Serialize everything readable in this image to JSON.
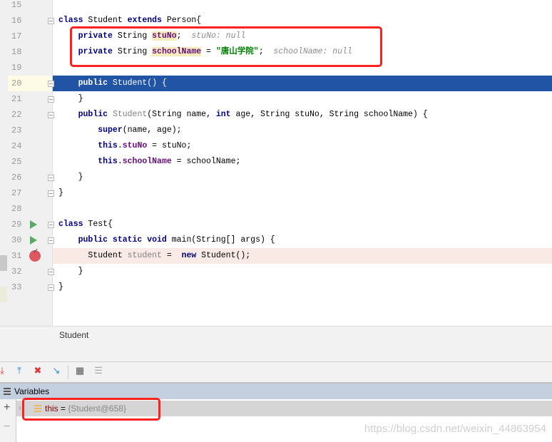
{
  "editor": {
    "lines": [
      {
        "n": "15",
        "tokens": []
      },
      {
        "n": "16",
        "tokens": [
          {
            "t": "class",
            "c": "kw"
          },
          {
            "t": " Student "
          },
          {
            "t": "extends",
            "c": "kw"
          },
          {
            "t": " Person{"
          }
        ]
      },
      {
        "n": "17",
        "tokens": [
          {
            "t": "    "
          },
          {
            "t": "private",
            "c": "kw"
          },
          {
            "t": " String "
          },
          {
            "t": "stuNo",
            "c": "dec"
          },
          {
            "t": ";  "
          },
          {
            "t": "stuNo: null",
            "c": "hint"
          }
        ]
      },
      {
        "n": "18",
        "tokens": [
          {
            "t": "    "
          },
          {
            "t": "private",
            "c": "kw"
          },
          {
            "t": " String "
          },
          {
            "t": "schoolName",
            "c": "dec"
          },
          {
            "t": " = "
          },
          {
            "t": "\"唐山学院\"",
            "c": "str"
          },
          {
            "t": ";  "
          },
          {
            "t": "schoolName: null",
            "c": "hint"
          }
        ]
      },
      {
        "n": "19",
        "tokens": []
      },
      {
        "n": "20",
        "tokens": [
          {
            "t": "    "
          },
          {
            "t": "public",
            "c": "kw"
          },
          {
            "t": " Student() {"
          }
        ]
      },
      {
        "n": "21",
        "tokens": [
          {
            "t": "    }"
          }
        ]
      },
      {
        "n": "22",
        "tokens": [
          {
            "t": "    "
          },
          {
            "t": "public",
            "c": "kw"
          },
          {
            "t": " "
          },
          {
            "t": "Student",
            "c": "gray"
          },
          {
            "t": "(String name, "
          },
          {
            "t": "int",
            "c": "kw"
          },
          {
            "t": " age, String stuNo, String schoolName) {"
          }
        ]
      },
      {
        "n": "23",
        "tokens": [
          {
            "t": "        "
          },
          {
            "t": "super",
            "c": "kw"
          },
          {
            "t": "(name, age);"
          }
        ]
      },
      {
        "n": "24",
        "tokens": [
          {
            "t": "        "
          },
          {
            "t": "this",
            "c": "kw"
          },
          {
            "t": "."
          },
          {
            "t": "stuNo",
            "c": "fld"
          },
          {
            "t": " = stuNo;"
          }
        ]
      },
      {
        "n": "25",
        "tokens": [
          {
            "t": "        "
          },
          {
            "t": "this",
            "c": "kw"
          },
          {
            "t": "."
          },
          {
            "t": "schoolName",
            "c": "fld"
          },
          {
            "t": " = schoolName;"
          }
        ]
      },
      {
        "n": "26",
        "tokens": [
          {
            "t": "    }"
          }
        ]
      },
      {
        "n": "27",
        "tokens": [
          {
            "t": "}"
          }
        ]
      },
      {
        "n": "28",
        "tokens": []
      },
      {
        "n": "29",
        "tokens": [
          {
            "t": "class",
            "c": "kw"
          },
          {
            "t": " Test{"
          }
        ]
      },
      {
        "n": "30",
        "tokens": [
          {
            "t": "    "
          },
          {
            "t": "public static void",
            "c": "kw"
          },
          {
            "t": " main(String[] args) {"
          }
        ]
      },
      {
        "n": "31",
        "tokens": [
          {
            "t": "      Student "
          },
          {
            "t": "student",
            "c": "gray"
          },
          {
            "t": " =  "
          },
          {
            "t": "new",
            "c": "kw"
          },
          {
            "t": " Student();"
          }
        ]
      },
      {
        "n": "32",
        "tokens": [
          {
            "t": "    }"
          }
        ]
      },
      {
        "n": "33",
        "tokens": [
          {
            "t": "}"
          }
        ]
      }
    ],
    "current_line": "20",
    "breakpoint_line": "31",
    "run_lines": [
      "29",
      "30"
    ],
    "fold_lines": [
      "16",
      "20",
      "21",
      "22",
      "26",
      "27",
      "29",
      "30",
      "32",
      "33"
    ]
  },
  "breadcrumb": "Student",
  "variables": {
    "title": "Variables",
    "row": {
      "name": "this",
      "eq": " = ",
      "value": "{Student@658}"
    }
  },
  "watermark": "https://blog.csdn.net/weixin_44863954",
  "colors": {
    "selection": "#2154a4",
    "highlight_box": "#ff2020",
    "breakpoint": "#db5860"
  }
}
